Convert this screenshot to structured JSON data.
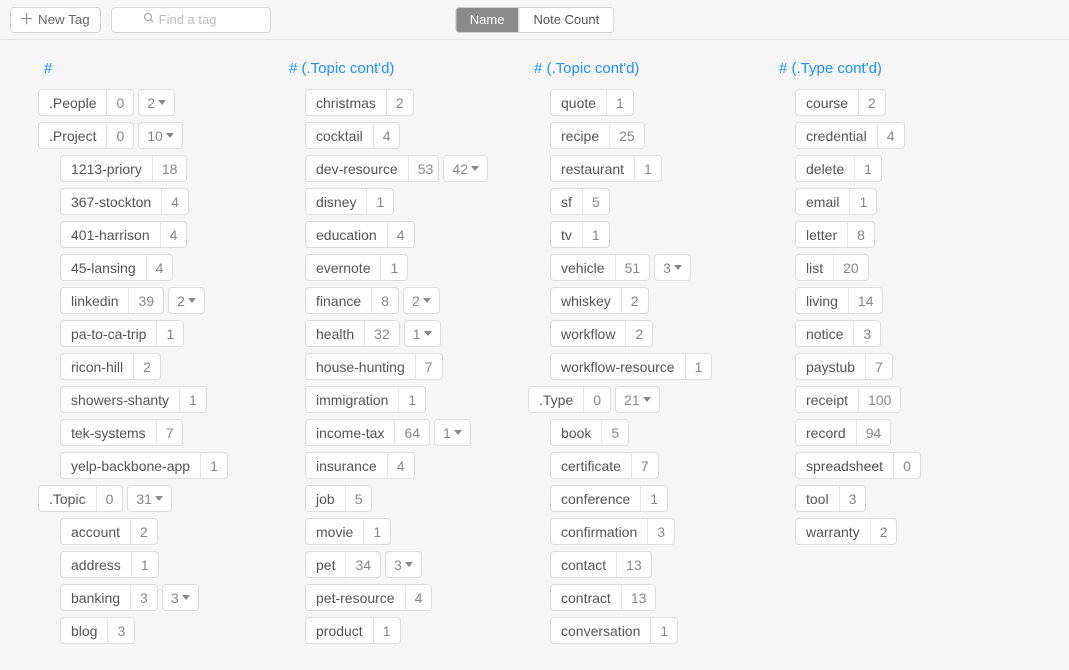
{
  "toolbar": {
    "newTag": "New Tag",
    "searchPlaceholder": "Find a tag",
    "segName": "Name",
    "segCount": "Note Count"
  },
  "columns": [
    {
      "header": "#",
      "tags": [
        {
          "name": ".People",
          "count": "0",
          "expand": "2",
          "indent": 0
        },
        {
          "name": ".Project",
          "count": "0",
          "expand": "10",
          "indent": 0
        },
        {
          "name": "1213-priory",
          "count": "18",
          "indent": 1
        },
        {
          "name": "367-stockton",
          "count": "4",
          "indent": 1
        },
        {
          "name": "401-harrison",
          "count": "4",
          "indent": 1
        },
        {
          "name": "45-lansing",
          "count": "4",
          "indent": 1
        },
        {
          "name": "linkedin",
          "count": "39",
          "expand": "2",
          "indent": 1
        },
        {
          "name": "pa-to-ca-trip",
          "count": "1",
          "indent": 1
        },
        {
          "name": "ricon-hill",
          "count": "2",
          "indent": 1
        },
        {
          "name": "showers-shanty",
          "count": "1",
          "indent": 1
        },
        {
          "name": "tek-systems",
          "count": "7",
          "indent": 1
        },
        {
          "name": "yelp-backbone-app",
          "count": "1",
          "indent": 1
        },
        {
          "name": ".Topic",
          "count": "0",
          "expand": "31",
          "indent": 0
        },
        {
          "name": "account",
          "count": "2",
          "indent": 1
        },
        {
          "name": "address",
          "count": "1",
          "indent": 1
        },
        {
          "name": "banking",
          "count": "3",
          "expand": "3",
          "indent": 1
        },
        {
          "name": "blog",
          "count": "3",
          "indent": 1
        }
      ]
    },
    {
      "header": "# (.Topic cont'd)",
      "tags": [
        {
          "name": "christmas",
          "count": "2",
          "indent": 1
        },
        {
          "name": "cocktail",
          "count": "4",
          "indent": 1
        },
        {
          "name": "dev-resource",
          "count": "53",
          "expand": "42",
          "indent": 1
        },
        {
          "name": "disney",
          "count": "1",
          "indent": 1
        },
        {
          "name": "education",
          "count": "4",
          "indent": 1
        },
        {
          "name": "evernote",
          "count": "1",
          "indent": 1
        },
        {
          "name": "finance",
          "count": "8",
          "expand": "2",
          "indent": 1
        },
        {
          "name": "health",
          "count": "32",
          "expand": "1",
          "indent": 1
        },
        {
          "name": "house-hunting",
          "count": "7",
          "indent": 1
        },
        {
          "name": "immigration",
          "count": "1",
          "indent": 1
        },
        {
          "name": "income-tax",
          "count": "64",
          "expand": "1",
          "indent": 1
        },
        {
          "name": "insurance",
          "count": "4",
          "indent": 1
        },
        {
          "name": "job",
          "count": "5",
          "indent": 1
        },
        {
          "name": "movie",
          "count": "1",
          "indent": 1
        },
        {
          "name": "pet",
          "count": "34",
          "expand": "3",
          "indent": 1
        },
        {
          "name": "pet-resource",
          "count": "4",
          "indent": 1
        },
        {
          "name": "product",
          "count": "1",
          "indent": 1
        }
      ]
    },
    {
      "header": "# (.Topic cont'd)",
      "tags": [
        {
          "name": "quote",
          "count": "1",
          "indent": 1
        },
        {
          "name": "recipe",
          "count": "25",
          "indent": 1
        },
        {
          "name": "restaurant",
          "count": "1",
          "indent": 1
        },
        {
          "name": "sf",
          "count": "5",
          "indent": 1
        },
        {
          "name": "tv",
          "count": "1",
          "indent": 1
        },
        {
          "name": "vehicle",
          "count": "51",
          "expand": "3",
          "indent": 1
        },
        {
          "name": "whiskey",
          "count": "2",
          "indent": 1
        },
        {
          "name": "workflow",
          "count": "2",
          "indent": 1
        },
        {
          "name": "workflow-resource",
          "count": "1",
          "indent": 1
        },
        {
          "name": ".Type",
          "count": "0",
          "expand": "21",
          "indent": 0
        },
        {
          "name": "book",
          "count": "5",
          "indent": 1
        },
        {
          "name": "certificate",
          "count": "7",
          "indent": 1
        },
        {
          "name": "conference",
          "count": "1",
          "indent": 1
        },
        {
          "name": "confirmation",
          "count": "3",
          "indent": 1
        },
        {
          "name": "contact",
          "count": "13",
          "indent": 1
        },
        {
          "name": "contract",
          "count": "13",
          "indent": 1
        },
        {
          "name": "conversation",
          "count": "1",
          "indent": 1
        }
      ]
    },
    {
      "header": "# (.Type cont'd)",
      "tags": [
        {
          "name": "course",
          "count": "2",
          "indent": 1
        },
        {
          "name": "credential",
          "count": "4",
          "indent": 1
        },
        {
          "name": "delete",
          "count": "1",
          "indent": 1
        },
        {
          "name": "email",
          "count": "1",
          "indent": 1
        },
        {
          "name": "letter",
          "count": "8",
          "indent": 1
        },
        {
          "name": "list",
          "count": "20",
          "indent": 1
        },
        {
          "name": "living",
          "count": "14",
          "indent": 1
        },
        {
          "name": "notice",
          "count": "3",
          "indent": 1
        },
        {
          "name": "paystub",
          "count": "7",
          "indent": 1
        },
        {
          "name": "receipt",
          "count": "100",
          "indent": 1
        },
        {
          "name": "record",
          "count": "94",
          "indent": 1
        },
        {
          "name": "spreadsheet",
          "count": "0",
          "indent": 1
        },
        {
          "name": "tool",
          "count": "3",
          "indent": 1
        },
        {
          "name": "warranty",
          "count": "2",
          "indent": 1
        }
      ]
    }
  ]
}
